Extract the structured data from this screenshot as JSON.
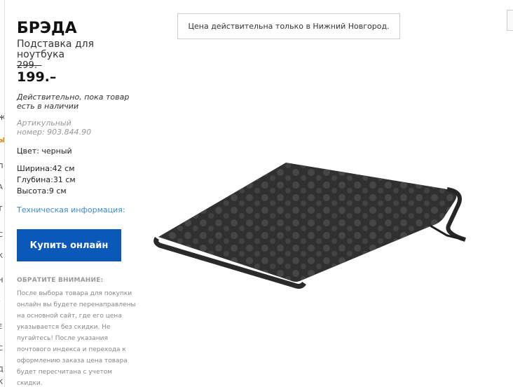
{
  "product": {
    "name": "БРЭДА",
    "description": "Подставка для ноутбука",
    "old_price": "299.–",
    "new_price": "199.–",
    "availability": "Действительно, пока товар есть в наличии",
    "article": "Артикульный номер: 903.844.90",
    "color": "Цвет: черный",
    "dimensions": [
      "Ширина:42 см",
      "Глубина:31 см",
      "Высота:9 см"
    ],
    "tech_link": "Техническая информация:",
    "buy_label": "Купить онлайн"
  },
  "notice": {
    "title": "ОБРАТИТЕ ВНИМАНИЕ:",
    "text": "После выбора товара для покупки онлайн вы будете перенаправлены на основной сайт, где его цена указывается без скидки. Не пугайтесь! После указания почтового индекса и перехода к оформлению заказа цена товара будет пересчитана с учетом скидки."
  },
  "city_notice": "Цена действительна только в Нижний Новгород.",
  "left_edge_chars": [
    "Ж",
    "Ы",
    "П",
    "А",
    "Т",
    "С",
    "К",
    "Н",
    "/",
    "Е",
    "С",
    "Д",
    "К"
  ],
  "colors": {
    "accent": "#0a58b8",
    "link": "#3a8ad8",
    "product": "#2e2e2e"
  },
  "icons": {
    "product_image": "laptop-stand-image"
  }
}
